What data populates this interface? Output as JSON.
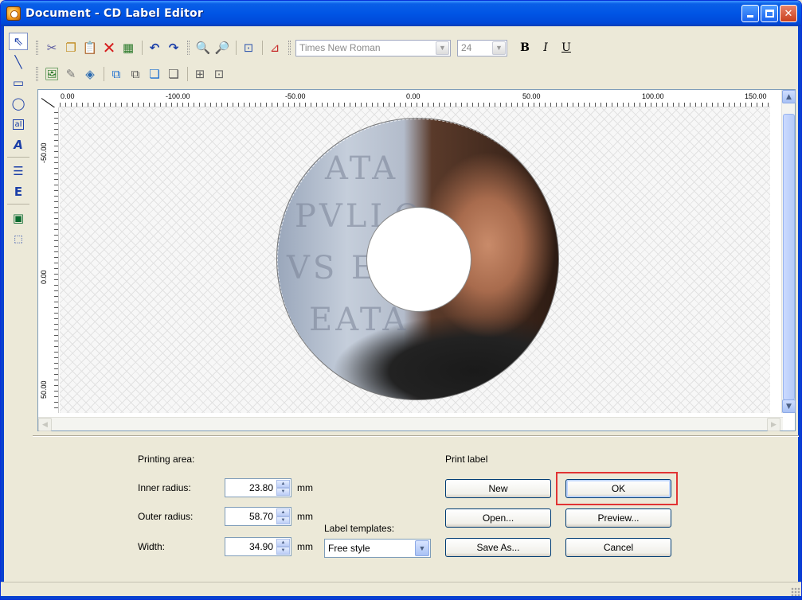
{
  "window": {
    "title": "Document - CD Label Editor"
  },
  "toolbar": {
    "font_name": "Times New Roman",
    "font_size": "24",
    "bold": "B",
    "italic": "I",
    "underline": "U"
  },
  "ruler": {
    "top_ticks": [
      "0.00",
      "-100.00",
      "-50.00",
      "0.00",
      "50.00",
      "100.00",
      "150.00"
    ],
    "left_ticks": [
      "-50.00",
      "0.00",
      "50.00"
    ]
  },
  "printing_area": {
    "heading": "Printing area:",
    "inner_radius_label": "Inner radius:",
    "inner_radius_value": "23.80",
    "outer_radius_label": "Outer radius:",
    "outer_radius_value": "58.70",
    "width_label": "Width:",
    "width_value": "34.90",
    "unit": "mm"
  },
  "templates": {
    "label": "Label templates:",
    "selected": "Free style"
  },
  "print_label": {
    "heading": "Print label",
    "new": "New",
    "ok": "OK",
    "open": "Open...",
    "preview": "Preview...",
    "save_as": "Save As...",
    "cancel": "Cancel"
  },
  "colors": {
    "title_bar": "#0055e5",
    "highlight": "#e13434",
    "face": "#ece9d8"
  }
}
